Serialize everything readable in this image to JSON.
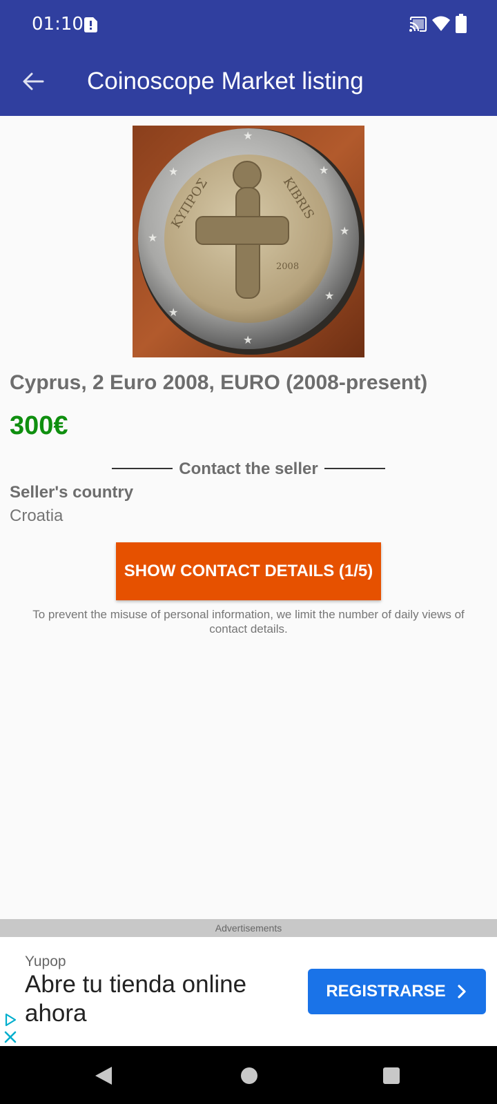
{
  "status_bar": {
    "time": "01:10"
  },
  "app_bar": {
    "title": "Coinoscope Market listing"
  },
  "coin_image": {
    "legend_left": "ΚΥΠΡΟΣ",
    "legend_right": "KIBRIS",
    "year": "2008"
  },
  "listing": {
    "title": "Cyprus, 2 Euro 2008, EURO (2008-present)",
    "price": "300€",
    "price_color": "#0f8f0f"
  },
  "seller": {
    "section_heading": "Contact the seller",
    "country_label": "Seller's country",
    "country_value": "Croatia"
  },
  "contact": {
    "button_label": "SHOW CONTACT DETAILS (1/5)",
    "button_color": "#e65100",
    "notice": "To prevent the misuse of personal information, we limit the number of daily views of contact details."
  },
  "ads": {
    "label": "Advertisements",
    "brand": "Yupop",
    "headline": "Abre tu tienda online ahora",
    "cta_label": "REGISTRARSE",
    "cta_color": "#1a73e8"
  },
  "icons": {
    "status": [
      "sim-alert-icon",
      "cast-icon",
      "wifi-icon",
      "battery-icon"
    ],
    "app_bar": [
      "back-arrow-icon"
    ],
    "ad": [
      "adchoices-icon",
      "close-icon",
      "chevron-right-icon"
    ],
    "nav": [
      "nav-back-icon",
      "nav-home-icon",
      "nav-recents-icon"
    ]
  },
  "theme": {
    "app_bar_color": "#303f9f"
  }
}
